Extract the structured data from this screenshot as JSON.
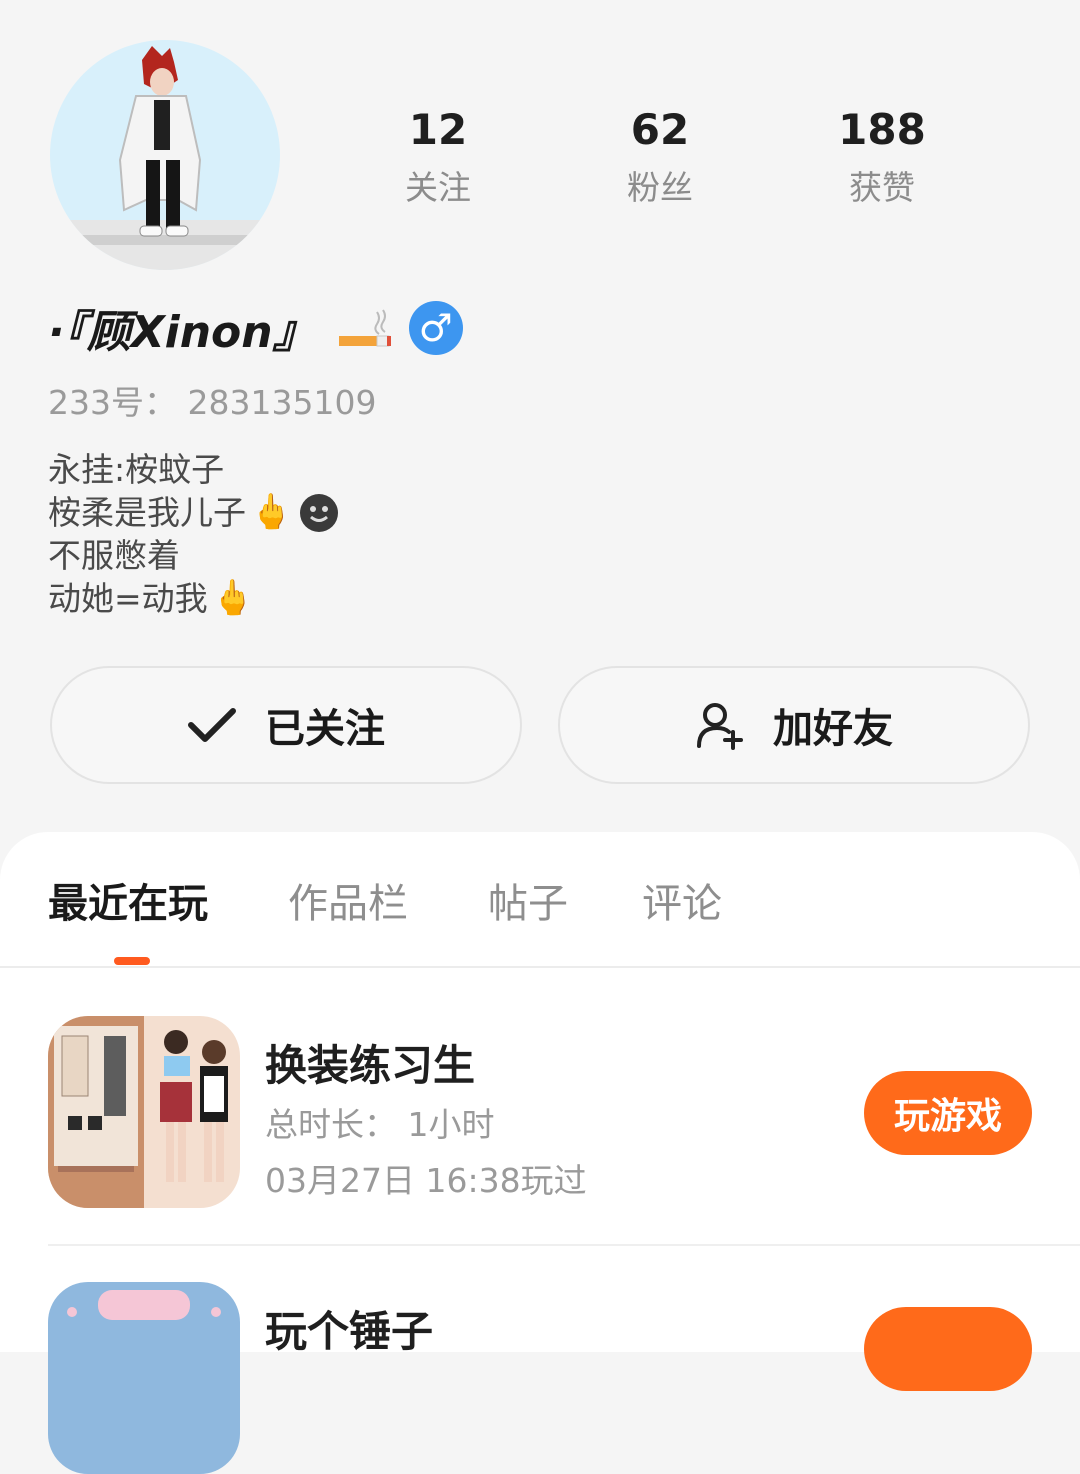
{
  "profile": {
    "name": "·『顾Xinon』",
    "gender_symbol": "♂",
    "uid": "233号： 283135109",
    "bio": [
      "永挂:桉蚊子",
      "桉柔是我儿子",
      "不服憋着",
      "动她=动我"
    ],
    "bio_emoji": "🖕"
  },
  "stats": [
    {
      "value": "12",
      "label": "关注"
    },
    {
      "value": "62",
      "label": "粉丝"
    },
    {
      "value": "188",
      "label": "获赞"
    }
  ],
  "actions": {
    "follow_label": "已关注",
    "add_friend_label": "加好友"
  },
  "tabs": [
    "最近在玩",
    "作品栏",
    "帖子",
    "评论"
  ],
  "games": [
    {
      "title": "换装练习生",
      "duration": "总时长： 1小时",
      "last_played": "03月27日 16:38玩过",
      "play_label": "玩游戏"
    },
    {
      "title": "玩个锤子"
    }
  ],
  "colors": {
    "accent": "#ff6a1a",
    "gender_badge": "#3d96f0",
    "tab_indicator": "#ff5a1f"
  }
}
